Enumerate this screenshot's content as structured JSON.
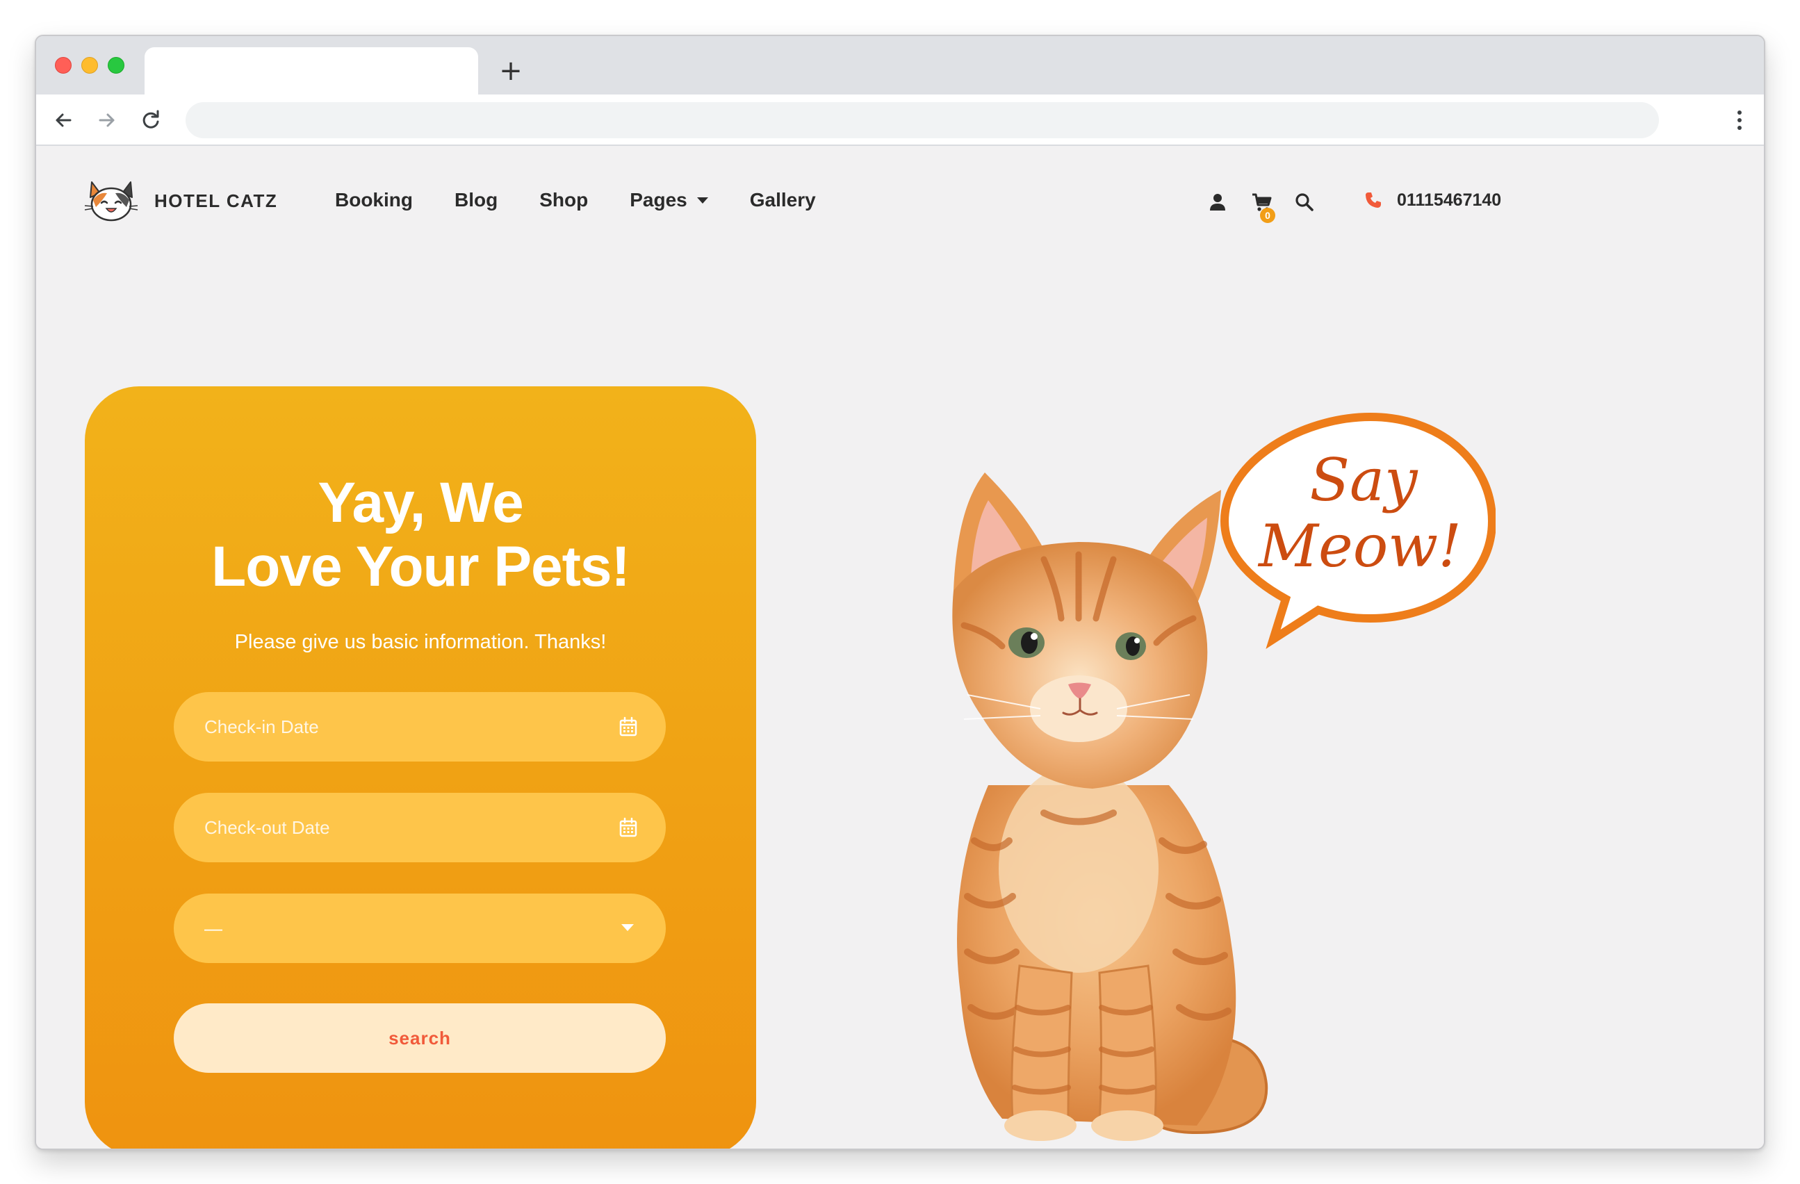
{
  "browser": {
    "tab_title": "",
    "new_tab_symbol": "+",
    "address": ""
  },
  "site": {
    "brand": "HOTEL CATZ",
    "menu": [
      {
        "label": "Booking"
      },
      {
        "label": "Blog"
      },
      {
        "label": "Shop"
      },
      {
        "label": "Pages",
        "has_dropdown": true
      },
      {
        "label": "Gallery"
      }
    ],
    "cart_count": "0",
    "phone": "01115467140",
    "icons": [
      "user-icon",
      "cart-icon",
      "search-icon",
      "phone-icon"
    ]
  },
  "booking": {
    "title_line1": "Yay, We",
    "title_line2": "Love Your Pets!",
    "subtitle": "Please give us basic information. Thanks!",
    "checkin_placeholder": "Check-in Date",
    "checkout_placeholder": "Check-out Date",
    "select_value": "—",
    "search_label": "search"
  },
  "hero": {
    "bubble_line1": "Say",
    "bubble_line2": "Meow!"
  },
  "colors": {
    "card_top": "#f2b21a",
    "card_bottom": "#ef9310",
    "field": "#fec54a",
    "button_bg": "#ffeac8",
    "button_text": "#f15a3a",
    "accent_orange": "#f29e17",
    "phone_red": "#f15a3a"
  }
}
